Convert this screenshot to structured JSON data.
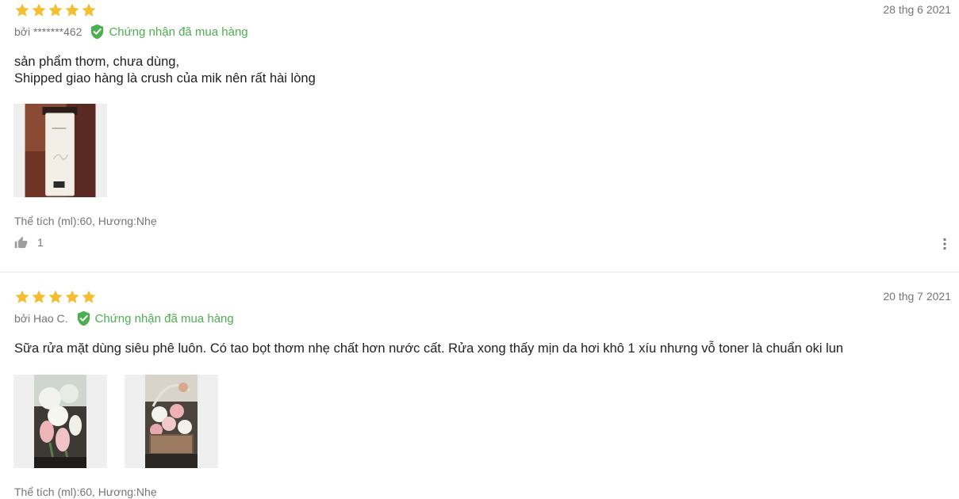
{
  "colors": {
    "star": "#f4be33",
    "verified": "#4caf50",
    "muted": "#757575",
    "text": "#212121"
  },
  "reviews": [
    {
      "rating": 5,
      "date": "28 thg 6 2021",
      "author": "bởi *******462",
      "verified_label": "Chứng nhận đã mua hàng",
      "content": "sản phẩm thơm, chưa dùng,\nShipped giao hàng là crush của mik nên rất hài lòng",
      "variant": "Thể tích (ml):60, Hương:Nhẹ",
      "likes": "1"
    },
    {
      "rating": 5,
      "date": "20 thg 7 2021",
      "author": "bởi Hao C.",
      "verified_label": "Chứng nhận đã mua hàng",
      "content": "Sữa rửa mặt dùng siêu phê luôn. Có tao bọt thơm nhẹ chất hơn nước cất. Rửa xong thấy mịn da hơi khô 1 xíu nhưng vỗ toner là chuẩn oki lun",
      "variant": "Thể tích (ml):60, Hương:Nhẹ"
    }
  ],
  "icons": {
    "star": "star-icon",
    "verified": "verified-check-icon",
    "like": "thumbs-up-icon",
    "more": "more-vertical-icon"
  }
}
